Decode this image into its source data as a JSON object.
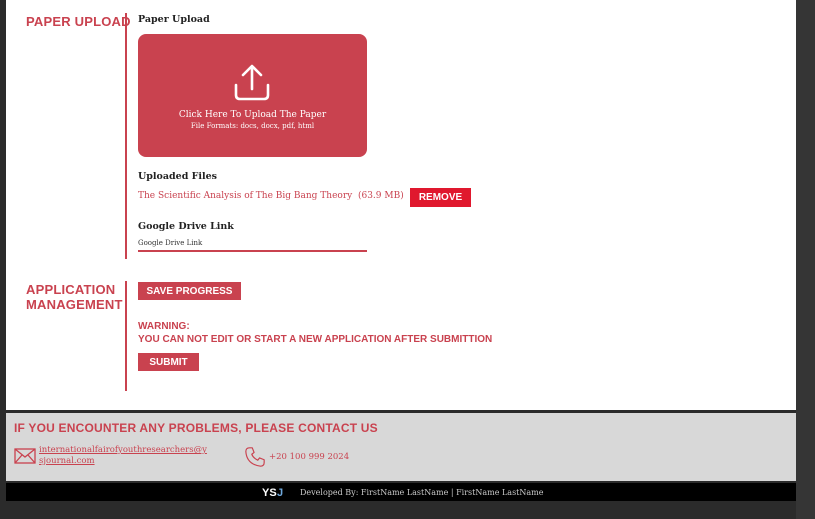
{
  "paper_upload": {
    "section_title": "Paper Upload",
    "field_label": "Paper Upload",
    "upload_main": "Click Here To Upload The Paper",
    "upload_formats": "File Formats: docs, docx, pdf, html",
    "uploaded_files_label": "Uploaded Files",
    "file_name": "The Scientific Analysis of The Big Bang Theory",
    "file_size": "(63.9 MB)",
    "remove_label": "Remove",
    "drive_label": "Google Drive Link",
    "drive_placeholder": "Google Drive Link"
  },
  "application": {
    "section_title_line1": "Application",
    "section_title_line2": "Management",
    "save_label": "Save Progress",
    "warning_title": "Warning:",
    "warning_text": "You can not edit or start a new application after submittion",
    "submit_label": "Submit"
  },
  "contact": {
    "title": "If you encounter any problems, please contact us",
    "email": "internationalfairofyouthresearchers@ysjournal.com",
    "phone": "+20 100 999 2024"
  },
  "footer": {
    "logo_text": "YSJ",
    "developed_by": "Developed By: FirstName LastName | FirstName LastName"
  },
  "colors": {
    "accent": "#c9424f",
    "remove": "#e0182e",
    "background": "#2b2b2b"
  }
}
